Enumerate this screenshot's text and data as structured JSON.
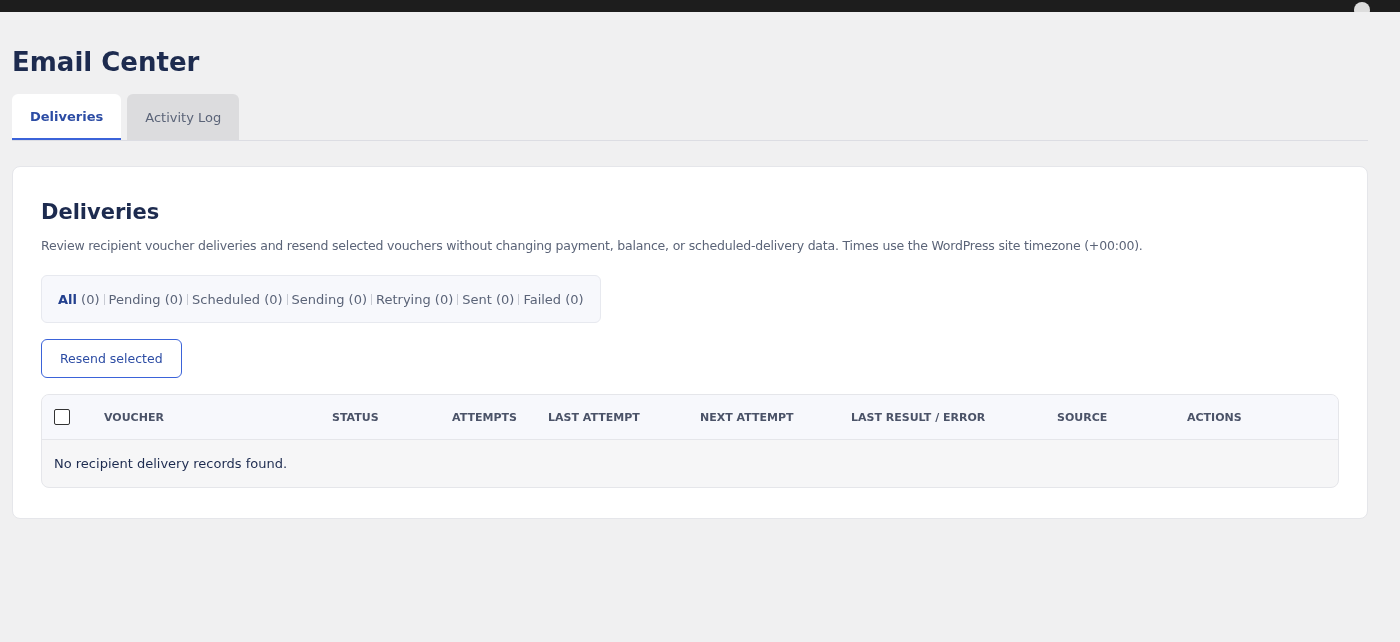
{
  "page_title": "Email Center",
  "tabs": [
    {
      "label": "Deliveries",
      "selected": true
    },
    {
      "label": "Activity Log",
      "selected": false
    }
  ],
  "panel": {
    "title": "Deliveries",
    "description": "Review recipient voucher deliveries and resend selected vouchers without changing payment, balance, or scheduled-delivery data. Times use the WordPress site timezone (+00:00).",
    "filters": [
      {
        "label": "All",
        "count": "(0)",
        "selected": true
      },
      {
        "label": "Pending",
        "count": "(0)",
        "selected": false
      },
      {
        "label": "Scheduled",
        "count": "(0)",
        "selected": false
      },
      {
        "label": "Sending",
        "count": "(0)",
        "selected": false
      },
      {
        "label": "Retrying",
        "count": "(0)",
        "selected": false
      },
      {
        "label": "Sent",
        "count": "(0)",
        "selected": false
      },
      {
        "label": "Failed",
        "count": "(0)",
        "selected": false
      }
    ],
    "action_button": "Resend selected",
    "table": {
      "select_all_checked": false,
      "columns": [
        "VOUCHER",
        "STATUS",
        "ATTEMPTS",
        "LAST ATTEMPT",
        "NEXT ATTEMPT",
        "LAST RESULT / ERROR",
        "SOURCE",
        "ACTIONS"
      ],
      "empty_message": "No recipient delivery records found."
    }
  }
}
